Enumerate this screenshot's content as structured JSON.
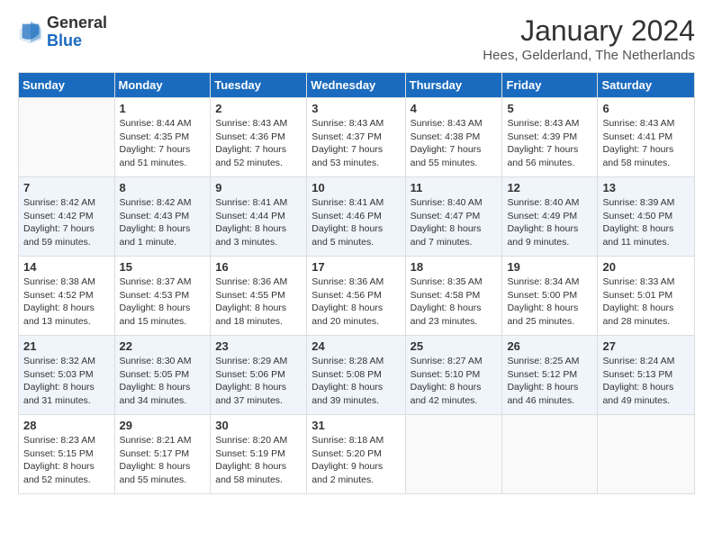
{
  "logo": {
    "general": "General",
    "blue": "Blue"
  },
  "header": {
    "month": "January 2024",
    "location": "Hees, Gelderland, The Netherlands"
  },
  "weekdays": [
    "Sunday",
    "Monday",
    "Tuesday",
    "Wednesday",
    "Thursday",
    "Friday",
    "Saturday"
  ],
  "weeks": [
    [
      {
        "day": "",
        "sunrise": "",
        "sunset": "",
        "daylight": ""
      },
      {
        "day": "1",
        "sunrise": "Sunrise: 8:44 AM",
        "sunset": "Sunset: 4:35 PM",
        "daylight": "Daylight: 7 hours and 51 minutes."
      },
      {
        "day": "2",
        "sunrise": "Sunrise: 8:43 AM",
        "sunset": "Sunset: 4:36 PM",
        "daylight": "Daylight: 7 hours and 52 minutes."
      },
      {
        "day": "3",
        "sunrise": "Sunrise: 8:43 AM",
        "sunset": "Sunset: 4:37 PM",
        "daylight": "Daylight: 7 hours and 53 minutes."
      },
      {
        "day": "4",
        "sunrise": "Sunrise: 8:43 AM",
        "sunset": "Sunset: 4:38 PM",
        "daylight": "Daylight: 7 hours and 55 minutes."
      },
      {
        "day": "5",
        "sunrise": "Sunrise: 8:43 AM",
        "sunset": "Sunset: 4:39 PM",
        "daylight": "Daylight: 7 hours and 56 minutes."
      },
      {
        "day": "6",
        "sunrise": "Sunrise: 8:43 AM",
        "sunset": "Sunset: 4:41 PM",
        "daylight": "Daylight: 7 hours and 58 minutes."
      }
    ],
    [
      {
        "day": "7",
        "sunrise": "Sunrise: 8:42 AM",
        "sunset": "Sunset: 4:42 PM",
        "daylight": "Daylight: 7 hours and 59 minutes."
      },
      {
        "day": "8",
        "sunrise": "Sunrise: 8:42 AM",
        "sunset": "Sunset: 4:43 PM",
        "daylight": "Daylight: 8 hours and 1 minute."
      },
      {
        "day": "9",
        "sunrise": "Sunrise: 8:41 AM",
        "sunset": "Sunset: 4:44 PM",
        "daylight": "Daylight: 8 hours and 3 minutes."
      },
      {
        "day": "10",
        "sunrise": "Sunrise: 8:41 AM",
        "sunset": "Sunset: 4:46 PM",
        "daylight": "Daylight: 8 hours and 5 minutes."
      },
      {
        "day": "11",
        "sunrise": "Sunrise: 8:40 AM",
        "sunset": "Sunset: 4:47 PM",
        "daylight": "Daylight: 8 hours and 7 minutes."
      },
      {
        "day": "12",
        "sunrise": "Sunrise: 8:40 AM",
        "sunset": "Sunset: 4:49 PM",
        "daylight": "Daylight: 8 hours and 9 minutes."
      },
      {
        "day": "13",
        "sunrise": "Sunrise: 8:39 AM",
        "sunset": "Sunset: 4:50 PM",
        "daylight": "Daylight: 8 hours and 11 minutes."
      }
    ],
    [
      {
        "day": "14",
        "sunrise": "Sunrise: 8:38 AM",
        "sunset": "Sunset: 4:52 PM",
        "daylight": "Daylight: 8 hours and 13 minutes."
      },
      {
        "day": "15",
        "sunrise": "Sunrise: 8:37 AM",
        "sunset": "Sunset: 4:53 PM",
        "daylight": "Daylight: 8 hours and 15 minutes."
      },
      {
        "day": "16",
        "sunrise": "Sunrise: 8:36 AM",
        "sunset": "Sunset: 4:55 PM",
        "daylight": "Daylight: 8 hours and 18 minutes."
      },
      {
        "day": "17",
        "sunrise": "Sunrise: 8:36 AM",
        "sunset": "Sunset: 4:56 PM",
        "daylight": "Daylight: 8 hours and 20 minutes."
      },
      {
        "day": "18",
        "sunrise": "Sunrise: 8:35 AM",
        "sunset": "Sunset: 4:58 PM",
        "daylight": "Daylight: 8 hours and 23 minutes."
      },
      {
        "day": "19",
        "sunrise": "Sunrise: 8:34 AM",
        "sunset": "Sunset: 5:00 PM",
        "daylight": "Daylight: 8 hours and 25 minutes."
      },
      {
        "day": "20",
        "sunrise": "Sunrise: 8:33 AM",
        "sunset": "Sunset: 5:01 PM",
        "daylight": "Daylight: 8 hours and 28 minutes."
      }
    ],
    [
      {
        "day": "21",
        "sunrise": "Sunrise: 8:32 AM",
        "sunset": "Sunset: 5:03 PM",
        "daylight": "Daylight: 8 hours and 31 minutes."
      },
      {
        "day": "22",
        "sunrise": "Sunrise: 8:30 AM",
        "sunset": "Sunset: 5:05 PM",
        "daylight": "Daylight: 8 hours and 34 minutes."
      },
      {
        "day": "23",
        "sunrise": "Sunrise: 8:29 AM",
        "sunset": "Sunset: 5:06 PM",
        "daylight": "Daylight: 8 hours and 37 minutes."
      },
      {
        "day": "24",
        "sunrise": "Sunrise: 8:28 AM",
        "sunset": "Sunset: 5:08 PM",
        "daylight": "Daylight: 8 hours and 39 minutes."
      },
      {
        "day": "25",
        "sunrise": "Sunrise: 8:27 AM",
        "sunset": "Sunset: 5:10 PM",
        "daylight": "Daylight: 8 hours and 42 minutes."
      },
      {
        "day": "26",
        "sunrise": "Sunrise: 8:25 AM",
        "sunset": "Sunset: 5:12 PM",
        "daylight": "Daylight: 8 hours and 46 minutes."
      },
      {
        "day": "27",
        "sunrise": "Sunrise: 8:24 AM",
        "sunset": "Sunset: 5:13 PM",
        "daylight": "Daylight: 8 hours and 49 minutes."
      }
    ],
    [
      {
        "day": "28",
        "sunrise": "Sunrise: 8:23 AM",
        "sunset": "Sunset: 5:15 PM",
        "daylight": "Daylight: 8 hours and 52 minutes."
      },
      {
        "day": "29",
        "sunrise": "Sunrise: 8:21 AM",
        "sunset": "Sunset: 5:17 PM",
        "daylight": "Daylight: 8 hours and 55 minutes."
      },
      {
        "day": "30",
        "sunrise": "Sunrise: 8:20 AM",
        "sunset": "Sunset: 5:19 PM",
        "daylight": "Daylight: 8 hours and 58 minutes."
      },
      {
        "day": "31",
        "sunrise": "Sunrise: 8:18 AM",
        "sunset": "Sunset: 5:20 PM",
        "daylight": "Daylight: 9 hours and 2 minutes."
      },
      {
        "day": "",
        "sunrise": "",
        "sunset": "",
        "daylight": ""
      },
      {
        "day": "",
        "sunrise": "",
        "sunset": "",
        "daylight": ""
      },
      {
        "day": "",
        "sunrise": "",
        "sunset": "",
        "daylight": ""
      }
    ]
  ]
}
